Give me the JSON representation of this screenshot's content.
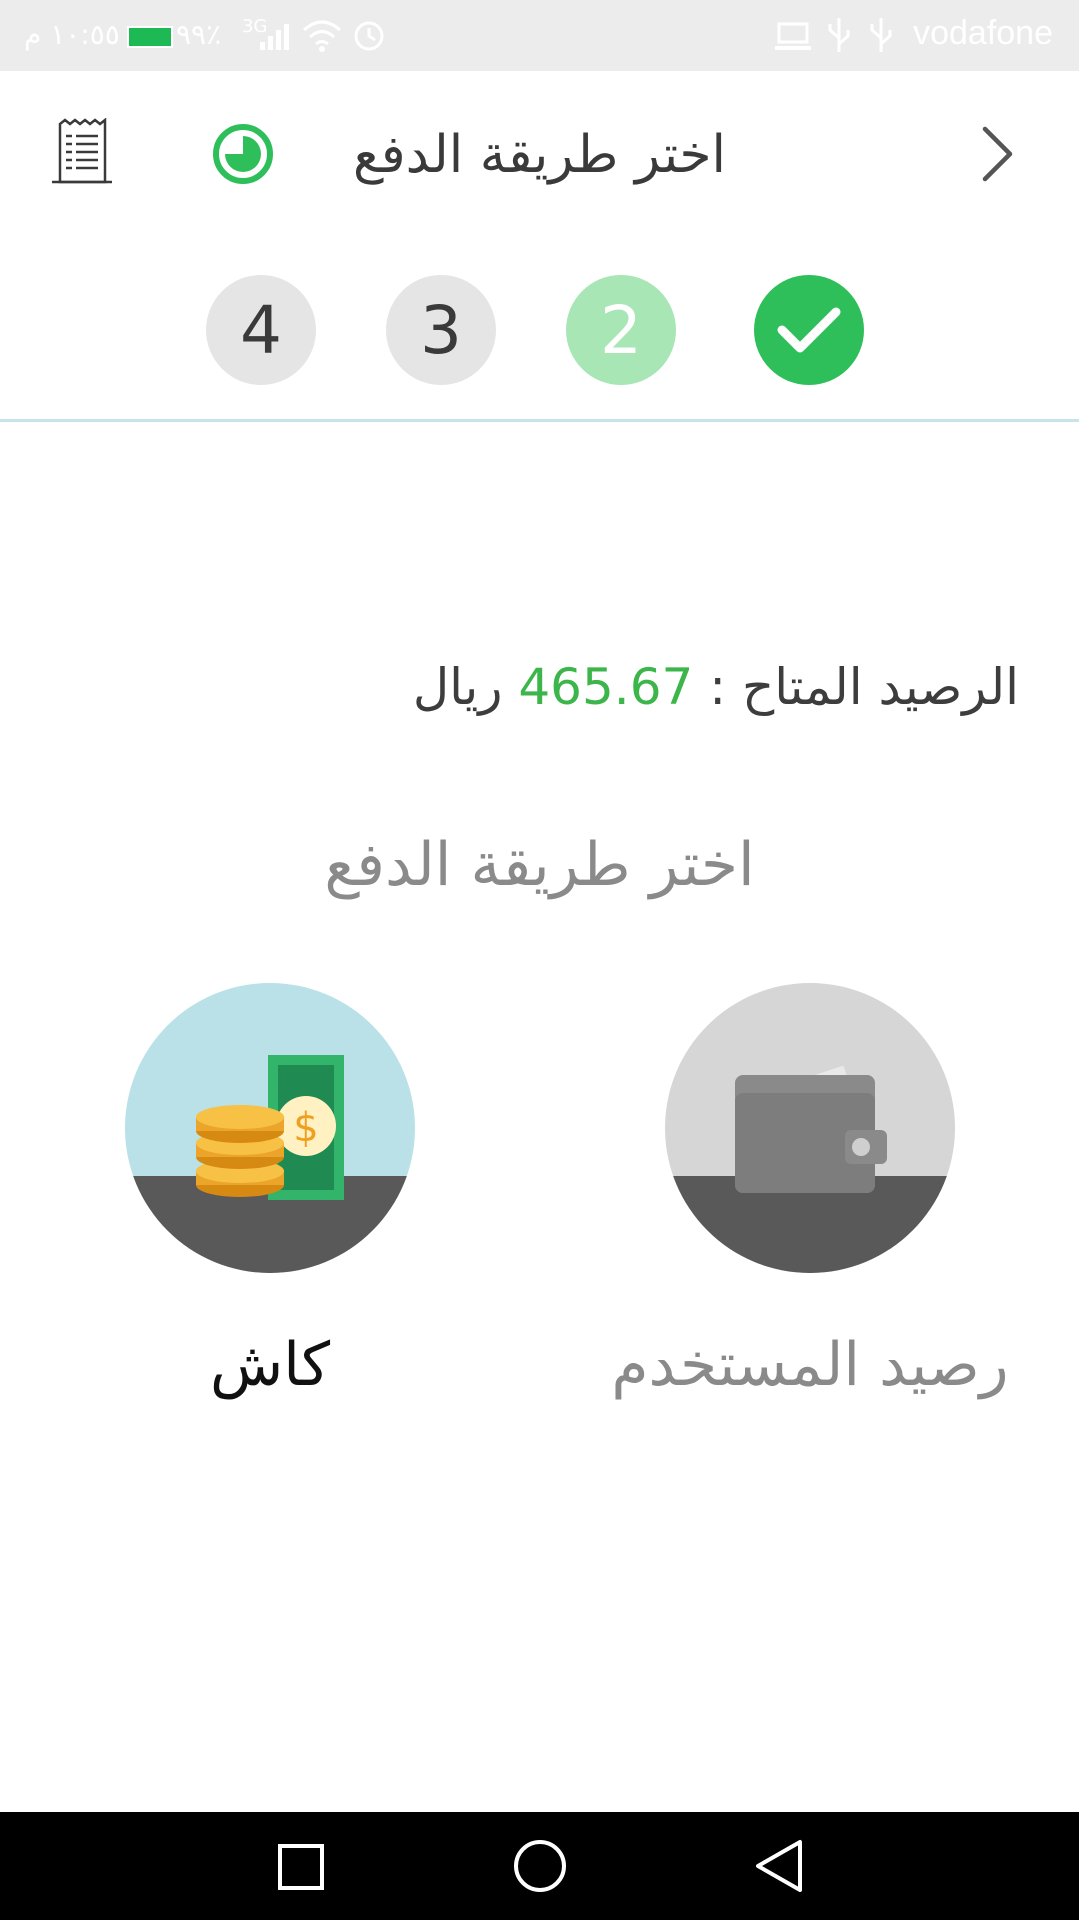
{
  "status_bar": {
    "time": "١٠:٥٥ م",
    "battery": "٩٩٪",
    "network": "3G",
    "carrier": "vodafone"
  },
  "header": {
    "title": "اختر طريقة الدفع",
    "back_icon": "chevron-right-icon",
    "history_icon": "clock-icon",
    "receipt_icon": "receipt-icon"
  },
  "stepper": {
    "steps": [
      {
        "label": "4",
        "state": "pending"
      },
      {
        "label": "3",
        "state": "pending"
      },
      {
        "label": "2",
        "state": "current"
      },
      {
        "label": "",
        "state": "done"
      }
    ]
  },
  "balance": {
    "label": "الرصيد المتاح :",
    "amount": "465.67",
    "currency": "ريال"
  },
  "payment": {
    "heading": "اختر طريقة الدفع",
    "options": [
      {
        "label": "كاش",
        "icon": "cash-icon"
      },
      {
        "label": "رصيد المستخدم",
        "icon": "wallet-icon"
      }
    ]
  },
  "colors": {
    "accent_green": "#2fbf5a",
    "current_step": "#a8e6b5",
    "amount_green": "#3cb54a"
  }
}
